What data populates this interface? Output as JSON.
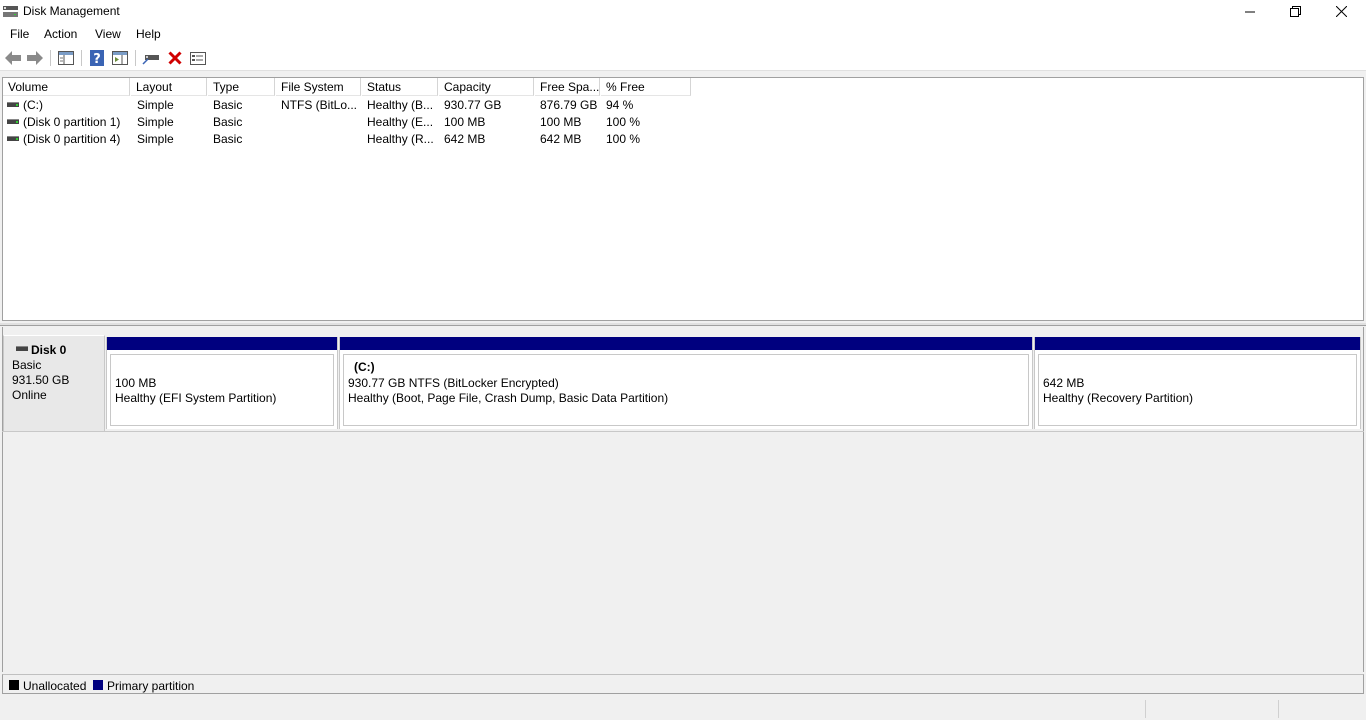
{
  "window": {
    "title": "Disk Management",
    "app_icon": "disk-management-icon"
  },
  "menu": [
    "File",
    "Action",
    "View",
    "Help"
  ],
  "toolbar": {
    "buttons": [
      "back-arrow-icon",
      "forward-arrow-icon",
      "show-hide-console-tree-icon",
      "help-icon",
      "properties-panel-icon",
      "connect-disk-icon",
      "delete-icon",
      "settings-list-icon"
    ]
  },
  "volume_list": {
    "columns": [
      "Volume",
      "Layout",
      "Type",
      "File System",
      "Status",
      "Capacity",
      "Free Spa...",
      "% Free"
    ],
    "rows": [
      {
        "volume": " (C:)",
        "layout": "Simple",
        "type": "Basic",
        "file_system": "NTFS (BitLo...",
        "status": "Healthy (B...",
        "capacity": "930.77 GB",
        "free_space": "876.79 GB",
        "pct_free": "94 %"
      },
      {
        "volume": "(Disk 0 partition 1)",
        "layout": "Simple",
        "type": "Basic",
        "file_system": "",
        "status": "Healthy (E...",
        "capacity": "100 MB",
        "free_space": "100 MB",
        "pct_free": "100 %"
      },
      {
        "volume": "(Disk 0 partition 4)",
        "layout": "Simple",
        "type": "Basic",
        "file_system": "",
        "status": "Healthy (R...",
        "capacity": "642 MB",
        "free_space": "642 MB",
        "pct_free": "100 %"
      }
    ]
  },
  "disk": {
    "name": "Disk 0",
    "type": "Basic",
    "size": "931.50 GB",
    "state": "Online",
    "partitions": [
      {
        "label": "",
        "size_line": "100 MB",
        "status_line": "Healthy (EFI System Partition)"
      },
      {
        "label": "(C:)",
        "size_line": "930.77 GB NTFS (BitLocker Encrypted)",
        "status_line": "Healthy (Boot, Page File, Crash Dump, Basic Data Partition)"
      },
      {
        "label": "",
        "size_line": "642 MB",
        "status_line": "Healthy (Recovery Partition)"
      }
    ]
  },
  "legend": [
    {
      "label": "Unallocated",
      "color": "#000000"
    },
    {
      "label": "Primary partition",
      "color": "#00007f"
    }
  ],
  "colors": {
    "primary_partition": "#00007f",
    "unallocated": "#000000"
  }
}
